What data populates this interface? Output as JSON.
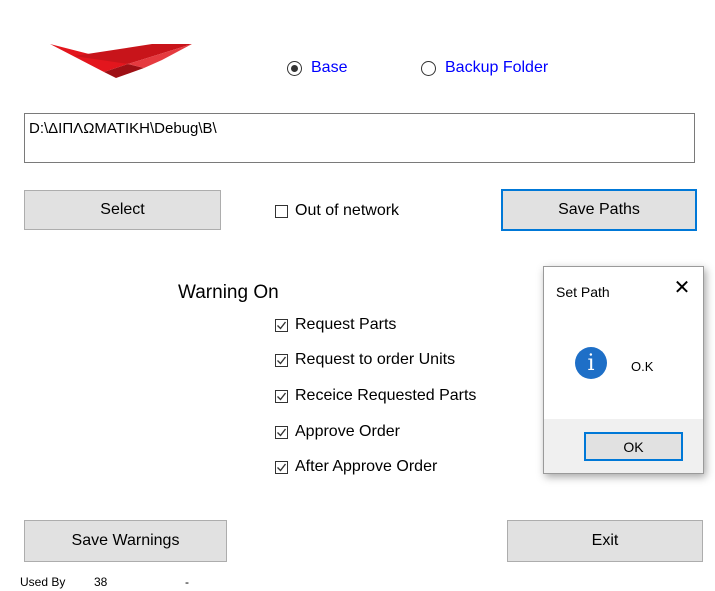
{
  "source_selector": {
    "base_label": "Base",
    "backup_label": "Backup Folder",
    "selected": "Base"
  },
  "path_value": "D:\\ΔΙΠΛΩΜΑΤΙΚΗ\\Debug\\B\\",
  "buttons": {
    "select": "Select",
    "save_paths": "Save Paths",
    "save_warnings": "Save Warnings",
    "exit": "Exit"
  },
  "out_of_network": {
    "label": "Out of network",
    "checked": false
  },
  "warnings": {
    "heading": "Warning On",
    "items": [
      {
        "label": "Request Parts",
        "checked": true
      },
      {
        "label": "Request to order Units",
        "checked": true
      },
      {
        "label": "Receice Requested Parts",
        "checked": true
      },
      {
        "label": "Approve Order",
        "checked": true
      },
      {
        "label": "After Approve Order",
        "checked": true
      }
    ]
  },
  "status_bar": {
    "used_by_label": "Used By",
    "used_by_value": "38",
    "extra": "-"
  },
  "dialog": {
    "title": "Set Path",
    "close_glyph": "✕",
    "icon_glyph": "i",
    "message": "O.K",
    "ok_label": "OK"
  },
  "colors": {
    "radio_text": "#0000ff",
    "accent_focus": "#0078d7",
    "info_icon": "#1e6fc7",
    "logo_red": "#e3161d"
  }
}
